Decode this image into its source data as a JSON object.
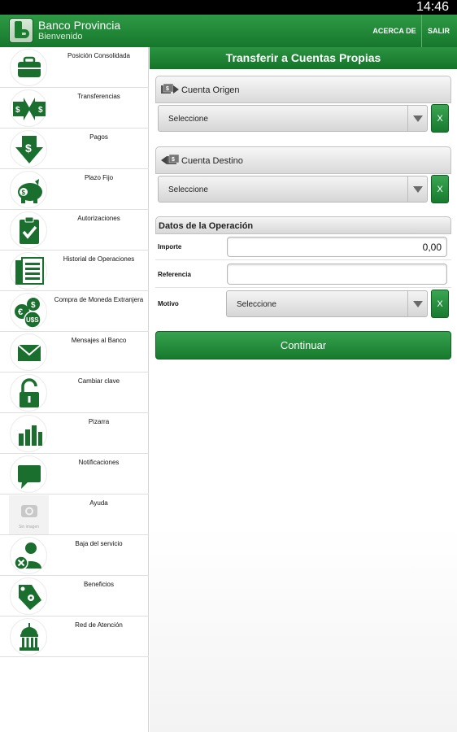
{
  "status_bar": {
    "time": "14:46"
  },
  "app": {
    "title": "Banco Provincia",
    "subtitle": "Bienvenido"
  },
  "header_actions": {
    "about": "ACERCA DE",
    "exit": "SALIR"
  },
  "sidebar": {
    "items": [
      {
        "label": "Posición Consolidada",
        "icon": "briefcase-icon"
      },
      {
        "label": "Transferencias",
        "icon": "transfer-arrows-icon"
      },
      {
        "label": "Pagos",
        "icon": "payment-arrow-icon"
      },
      {
        "label": "Plazo Fijo",
        "icon": "piggy-bank-icon"
      },
      {
        "label": "Autorizaciones",
        "icon": "clipboard-check-icon"
      },
      {
        "label": "Historial de Operaciones",
        "icon": "documents-icon"
      },
      {
        "label": "Compra de Moneda Extranjera",
        "icon": "currency-coins-icon"
      },
      {
        "label": "Mensajes al Banco",
        "icon": "envelope-icon"
      },
      {
        "label": "Cambiar clave",
        "icon": "padlock-icon"
      },
      {
        "label": "Pizarra",
        "icon": "bar-chart-icon"
      },
      {
        "label": "Notificaciones",
        "icon": "speech-bubble-icon"
      },
      {
        "label": "Ayuda",
        "icon": "placeholder-image-icon",
        "placeholder_text": "Sin imagen"
      },
      {
        "label": "Baja del servicio",
        "icon": "user-remove-icon"
      },
      {
        "label": "Beneficios",
        "icon": "tag-icon"
      },
      {
        "label": "Red de Atención",
        "icon": "bank-building-icon"
      }
    ]
  },
  "main": {
    "title": "Transferir a Cuentas Propias",
    "cuenta_origen": {
      "label": "Cuenta Origen",
      "select_value": "Seleccione",
      "clear_label": "X"
    },
    "cuenta_destino": {
      "label": "Cuenta Destino",
      "select_value": "Seleccione",
      "clear_label": "X"
    },
    "datos": {
      "header": "Datos de la Operación",
      "importe_label": "Importe",
      "importe_value": "0,00",
      "referencia_label": "Referencia",
      "referencia_value": "",
      "motivo_label": "Motivo",
      "motivo_value": "Seleccione",
      "motivo_clear": "X"
    },
    "continue_label": "Continuar"
  },
  "colors": {
    "brand_green": "#1b8233",
    "icon_green": "#1a6e2e"
  }
}
